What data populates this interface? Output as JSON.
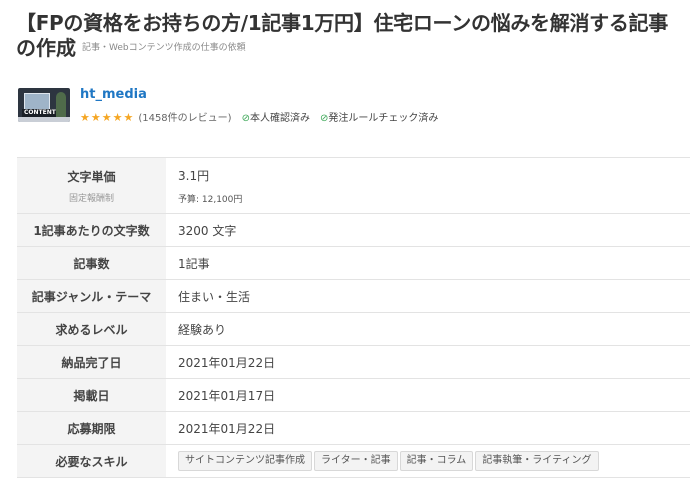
{
  "job": {
    "title_line1": "【FPの資格をお持ちの方/1記事1万円】住宅ローンの悩みを解消する記事",
    "title_line2": "の作成",
    "subtitle": "記事・Webコンテンツ作成の仕事の依頼"
  },
  "client": {
    "avatar_label": "CONTENT",
    "name": "ht_media",
    "stars": "★★★★★",
    "reviews": "(1458件のレビュー)",
    "check_icon": "⊘",
    "identity_verified": "本人確認済み",
    "rules_checked": "発注ルールチェック済み"
  },
  "details": {
    "price_label": "文字単価",
    "price_sublabel": "固定報酬制",
    "price_value": "3.1円",
    "budget": "予算: 12,100円",
    "chars_label": "1記事あたりの文字数",
    "chars_value": "3200 文字",
    "count_label": "記事数",
    "count_value": "1記事",
    "genre_label": "記事ジャンル・テーマ",
    "genre_value": "住まい・生活",
    "level_label": "求めるレベル",
    "level_value": "経験あり",
    "deadline_label": "納品完了日",
    "deadline_value": "2021年01月22日",
    "posted_label": "掲載日",
    "posted_value": "2021年01月17日",
    "apply_label": "応募期限",
    "apply_value": "2021年01月22日",
    "skills_label": "必要なスキル",
    "skills": [
      "サイトコンテンツ記事作成",
      "ライター・記事",
      "記事・コラム",
      "記事執筆・ライティング"
    ]
  },
  "colors": {
    "link": "#1f77c4",
    "star": "#f5a623",
    "check": "#3aa655",
    "header_bg": "#f4f4f4"
  }
}
